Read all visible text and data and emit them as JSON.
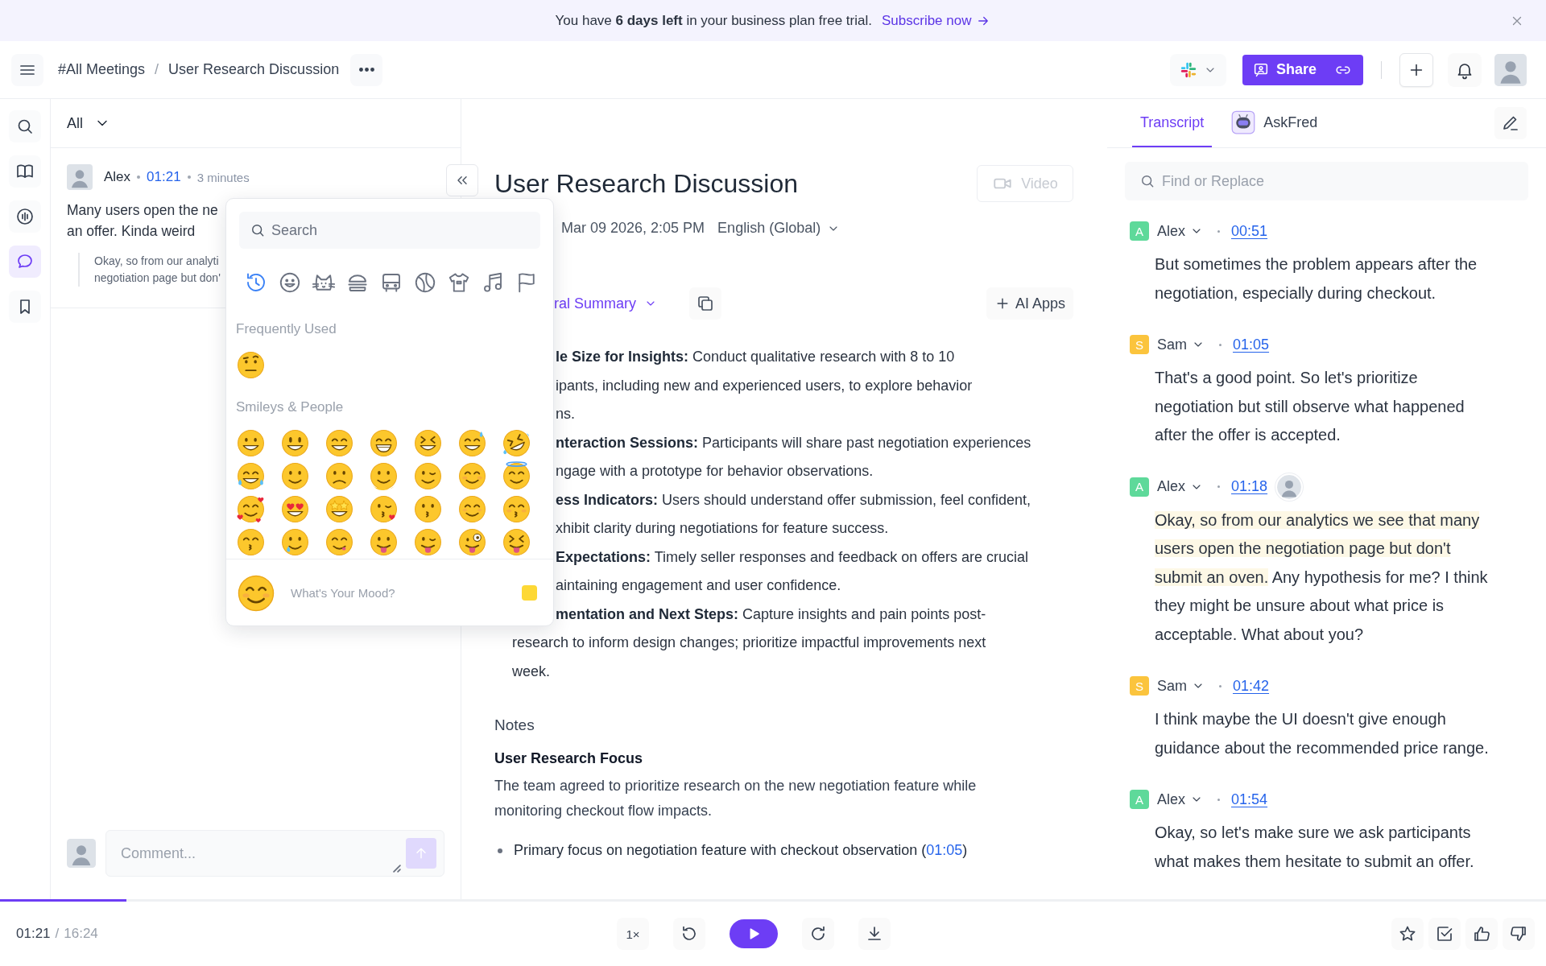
{
  "banner": {
    "message": "You have **6 days left** in your business plan free trial.",
    "link": "Subscribe now"
  },
  "header": {
    "breadcrumb": [
      "#All Meetings",
      "User Research Discussion"
    ],
    "separator": "/",
    "share_label": "Share"
  },
  "rail": {
    "items": [
      {
        "kind": "search",
        "selected": false
      },
      {
        "kind": "book",
        "selected": false
      },
      {
        "kind": "wave",
        "selected": false
      },
      {
        "kind": "chat",
        "selected": true
      },
      {
        "kind": "bookmark",
        "selected": false
      }
    ]
  },
  "comments": {
    "filter": "All",
    "items": [
      {
        "author": "Alex",
        "time": "01:21",
        "age": "3 minutes",
        "lines": [
          "Many users open the ne",
          "an offer. Kinda weird"
        ],
        "quote": [
          "Okay, so from our analyti",
          "negotiation page but don'"
        ]
      }
    ],
    "input": {
      "placeholder": "Comment...",
      "send_disabled": true
    }
  },
  "emoji_picker": {
    "search_placeholder": "Search",
    "categories": [
      {
        "kind": "recent",
        "selected": true
      },
      {
        "kind": "smileys",
        "selected": false
      },
      {
        "kind": "animals",
        "selected": false
      },
      {
        "kind": "food",
        "selected": false
      },
      {
        "kind": "travel",
        "selected": false
      },
      {
        "kind": "activities",
        "selected": false
      },
      {
        "kind": "objects",
        "selected": false
      },
      {
        "kind": "music",
        "selected": false
      },
      {
        "kind": "flags",
        "selected": false
      }
    ],
    "sections": [
      {
        "title": "Frequently Used",
        "emoji": [
          {
            "kind": "eyebrow"
          }
        ]
      },
      {
        "title": "Smileys & People",
        "emoji": [
          {
            "kind": "grinning"
          },
          {
            "kind": "smiley"
          },
          {
            "kind": "grin"
          },
          {
            "kind": "beaming"
          },
          {
            "kind": "laughing"
          },
          {
            "kind": "sweat"
          },
          {
            "kind": "rofl"
          },
          {
            "kind": "joy"
          },
          {
            "kind": "smile"
          },
          {
            "kind": "upside"
          },
          {
            "kind": "melting"
          },
          {
            "kind": "wink"
          },
          {
            "kind": "blush"
          },
          {
            "kind": "halo"
          },
          {
            "kind": "hearts"
          },
          {
            "kind": "hearteyes"
          },
          {
            "kind": "starstruck"
          },
          {
            "kind": "kissheart"
          },
          {
            "kind": "kissing"
          },
          {
            "kind": "relaxed"
          },
          {
            "kind": "kissclosed"
          },
          {
            "kind": "kisssmile"
          },
          {
            "kind": "tear"
          },
          {
            "kind": "yum"
          },
          {
            "kind": "tongue"
          },
          {
            "kind": "winktongue"
          },
          {
            "kind": "zany"
          },
          {
            "kind": "squinttongue"
          }
        ]
      }
    ],
    "mood": {
      "kind": "blush",
      "placeholder": "What's Your Mood?"
    }
  },
  "meeting": {
    "title": "User Research Discussion",
    "video": {
      "label": "Video",
      "disabled": true
    },
    "date": "Mar 09 2026, 2:05 PM",
    "language": "English (Global)",
    "summary_type": "ral Summary",
    "ai_apps": "AI Apps",
    "summary": [
      {
        "kind": "partial",
        "text": "**le Size for Insights:** Conduct qualitative research with 8 to 10"
      },
      {
        "kind": "partial",
        "text": "ipants, including new and experienced users, to explore behavior"
      },
      {
        "kind": "partial",
        "text": "ns."
      },
      {
        "kind": "partial",
        "text": "**nteraction Sessions:** Participants will share past negotiation experiences"
      },
      {
        "kind": "partial",
        "text": "ngage with a prototype for behavior observations."
      },
      {
        "kind": "partial",
        "text": "**ess Indicators:** Users should understand offer submission, feel confident,"
      },
      {
        "kind": "partial",
        "text": "xhibit clarity during negotiations for feature success."
      },
      {
        "kind": "partial",
        "text": "**Expectations:** Timely seller responses and feedback on offers are crucial"
      },
      {
        "kind": "partial",
        "text": "aintaining engagement and user confidence."
      },
      {
        "kind": "partial",
        "text": "**mentation and Next Steps:** Capture insights and pain points post-"
      },
      {
        "kind": "full",
        "text": "research to inform design changes; prioritize impactful improvements next"
      },
      {
        "kind": "full",
        "text": "week."
      }
    ],
    "notes": {
      "heading": "Notes",
      "subheading": "User Research Focus",
      "paragraph": "The team agreed to prioritize research on the new negotiation feature while monitoring checkout flow impacts.",
      "bullets": [
        {
          "text": "Primary focus on negotiation feature with checkout observation (",
          "link": "01:05",
          "after": ")"
        }
      ]
    }
  },
  "transcript": {
    "tabs": [
      {
        "label": "Transcript",
        "kind": "text",
        "selected": true
      },
      {
        "label": "AskFred",
        "kind": "bot",
        "selected": false
      }
    ],
    "search_placeholder": "Find or Replace",
    "entries": [
      {
        "speaker": "Alex",
        "initial": "A",
        "color": "#5ed99a",
        "time": "00:51",
        "has_avatar": false,
        "text": "But sometimes the problem appears after the negotiation, especially during checkout."
      },
      {
        "speaker": "Sam",
        "initial": "S",
        "color": "#fbc43d",
        "time": "01:05",
        "has_avatar": false,
        "text": "That's a good point. So let's prioritize negotiation but still observe what happened after the offer is accepted."
      },
      {
        "speaker": "Alex",
        "initial": "A",
        "color": "#5ed99a",
        "time": "01:18",
        "has_avatar": true,
        "highlight": "Okay, so from our analytics we see that many users open the negotiation page but don't submit an oven.",
        "text": " Any hypothesis for me? I think they might be unsure about what price is acceptable. What about you?"
      },
      {
        "speaker": "Sam",
        "initial": "S",
        "color": "#fbc43d",
        "time": "01:42",
        "has_avatar": false,
        "text": "I think maybe the UI doesn't give enough guidance about the recommended price range."
      },
      {
        "speaker": "Alex",
        "initial": "A",
        "color": "#5ed99a",
        "time": "01:54",
        "has_avatar": false,
        "text": "Okay, so let's make sure we ask participants what makes them hesitate to submit an offer."
      }
    ]
  },
  "player": {
    "current": "01:21",
    "separator": "/",
    "total": "16:24",
    "level": 0.082,
    "speed": "1×"
  }
}
